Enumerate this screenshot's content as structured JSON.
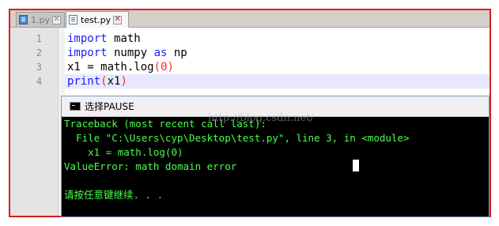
{
  "tabs": [
    {
      "label": "1.py",
      "icon": "python-file-icon",
      "active": false
    },
    {
      "label": "test.py",
      "icon": "python-file-icon",
      "active": true
    }
  ],
  "editor": {
    "line_numbers": [
      "1",
      "2",
      "3",
      "4"
    ],
    "lines": [
      [
        {
          "t": "import",
          "c": "kw"
        },
        {
          "t": " math"
        }
      ],
      [
        {
          "t": "import",
          "c": "kw"
        },
        {
          "t": " numpy "
        },
        {
          "t": "as",
          "c": "kw"
        },
        {
          "t": " np"
        }
      ],
      [
        {
          "t": "x1 = math.log"
        },
        {
          "t": "(",
          "c": "paren"
        },
        {
          "t": "0",
          "c": "num"
        },
        {
          "t": ")",
          "c": "paren"
        }
      ],
      [
        {
          "t": "print",
          "c": "kw"
        },
        {
          "t": "(",
          "c": "paren"
        },
        {
          "t": "x1"
        },
        {
          "t": ")",
          "c": "paren"
        }
      ]
    ],
    "current_line": 4,
    "colors": {
      "keyword": "#1a1aff",
      "number": "#ff2a2a",
      "paren": "#ff2a2a"
    }
  },
  "console": {
    "title": "选择PAUSE",
    "watermark": "http://blog.csdn.net/",
    "lines": [
      "Traceback (most recent call last):",
      "  File \"C:\\Users\\cyp\\Desktop\\test.py\", line 3, in <module>",
      "    x1 = math.log(0)",
      "ValueError: math domain error",
      "",
      "请按任意键继续. . ."
    ],
    "text_color": "#4cff4c"
  },
  "highlight_border_color": "#d9201c"
}
